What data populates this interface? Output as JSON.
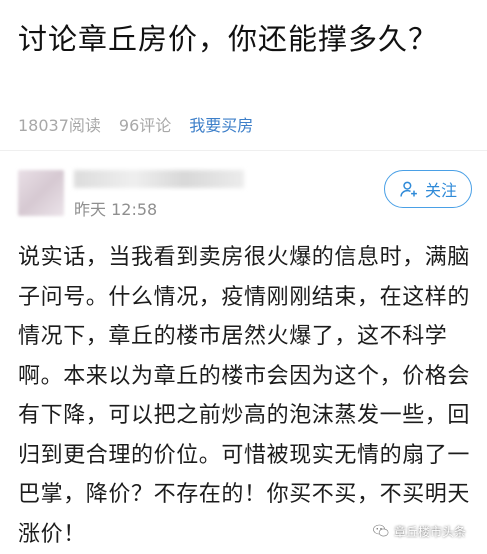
{
  "question": {
    "title": "讨论章丘房价，你还能撑多久？"
  },
  "meta": {
    "reads": "18037阅读",
    "comments": "96评论",
    "topic": "我要买房"
  },
  "answer": {
    "time": "昨天 12:58",
    "follow_label": "关注",
    "content": "说实话，当我看到卖房很火爆的信息时，满脑子问号。什么情况，疫情刚刚结束，在这样的情况下，章丘的楼市居然火爆了，这不科学啊。本来以为章丘的楼市会因为这个，价格会有下降，可以把之前炒高的泡沫蒸发一些，回归到更合理的价位。可惜被现实无情的扇了一巴掌，降价？不存在的！你买不买，不买明天涨价！"
  },
  "watermark": {
    "label": "章丘楼市头条"
  },
  "colors": {
    "accent": "#2f8ad8",
    "meta_gray": "#a8a8a8",
    "topic_blue": "#3d7fc9"
  },
  "icons": {
    "follow": "add-person-icon",
    "watermark": "wechat-logo-icon"
  }
}
